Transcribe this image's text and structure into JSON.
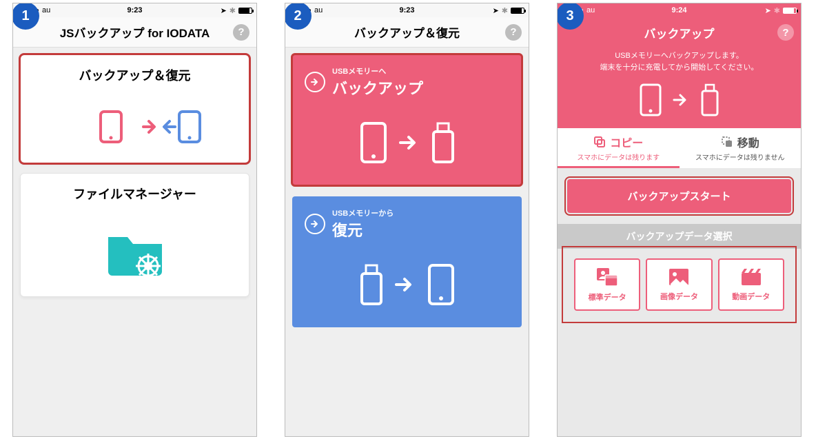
{
  "carrier": "au",
  "screens": [
    {
      "step": "1",
      "time": "9:23",
      "title": "JSバックアップ for IODATA",
      "cards": [
        {
          "title": "バックアップ＆復元",
          "highlight": true
        },
        {
          "title": "ファイルマネージャー",
          "highlight": false
        }
      ]
    },
    {
      "step": "2",
      "time": "9:23",
      "title": "バックアップ＆復元",
      "backup": {
        "sub": "USBメモリーへ",
        "label": "バックアップ",
        "highlight": true
      },
      "restore": {
        "sub": "USBメモリーから",
        "label": "復元",
        "highlight": false
      }
    },
    {
      "step": "3",
      "time": "9:24",
      "title": "バックアップ",
      "msg1": "USBメモリーへバックアップします。",
      "msg2": "端末を十分に充電してから開始してください。",
      "tabs": {
        "copy": {
          "label": "コピー",
          "sub": "スマホにデータは残ります"
        },
        "move": {
          "label": "移動",
          "sub": "スマホにデータは残りません"
        }
      },
      "start_label": "バックアップスタート",
      "section_label": "バックアップデータ選択",
      "selections": [
        {
          "label": "標準データ"
        },
        {
          "label": "画像データ"
        },
        {
          "label": "動画データ"
        }
      ]
    }
  ]
}
